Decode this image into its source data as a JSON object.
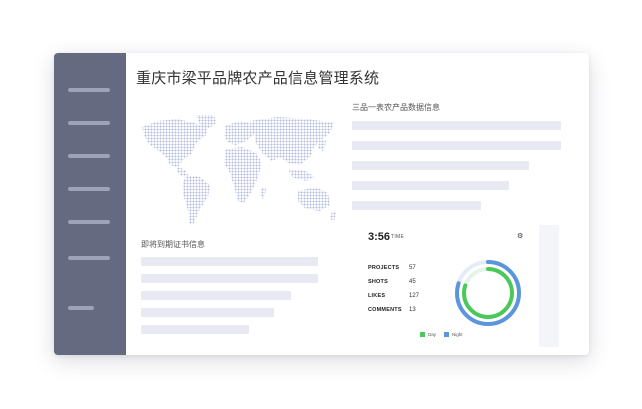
{
  "app": {
    "title": "重庆市梁平品牌农产品信息管理系统"
  },
  "sections": {
    "product_info_title": "三品一表农产品数据信息",
    "expiring_title": "即将到期证书信息"
  },
  "widget": {
    "time": "3:56",
    "time_label": "TIME",
    "settings_icon": "gear-icon",
    "stats": [
      {
        "label": "PROJECTS",
        "value": "57"
      },
      {
        "label": "SHOTS",
        "value": "45"
      },
      {
        "label": "LIKES",
        "value": "127"
      },
      {
        "label": "COMMENTS",
        "value": "13"
      }
    ],
    "ring": {
      "day_fraction": 0.8,
      "night_fraction": 0.8
    },
    "legend": {
      "day": "Day",
      "night": "Night"
    }
  },
  "colors": {
    "sidebar_bg": "#656a80",
    "sidebar_line": "#9ea2b6",
    "placeholder_bar": "#e9e9f3",
    "map_dot": "#b2b8dc",
    "day": "#4cc85a",
    "night": "#5b96dc"
  }
}
